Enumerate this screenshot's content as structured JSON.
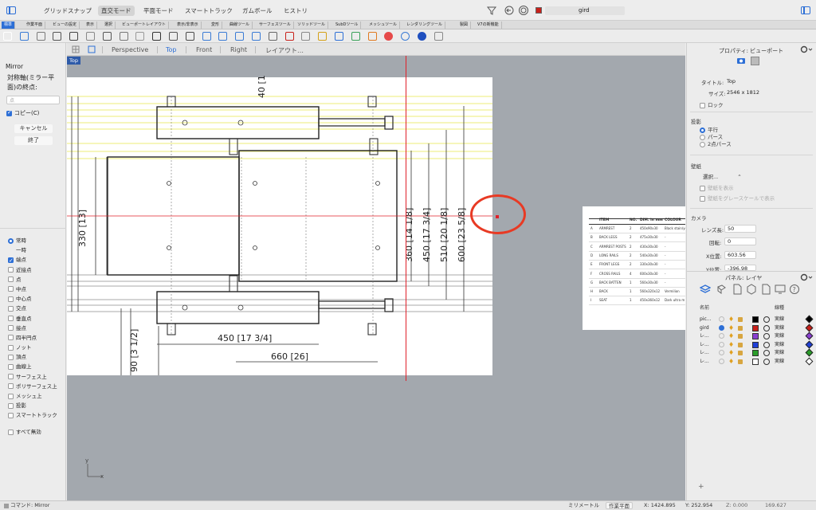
{
  "modebar": {
    "modes": [
      "グリッドスナップ",
      "直交モード",
      "平面モード",
      "スマートトラック",
      "ガムボール",
      "ヒストリ"
    ],
    "active_mode": "直交モード",
    "layer_name": "gird",
    "layer_color": "#c8201a"
  },
  "tabs": [
    "標準",
    "作業平面",
    "ビューの設定",
    "表示",
    "選択",
    "ビューポートレイアウト",
    "表示/非表示",
    "変形",
    "曲線ツール",
    "サーフェスツール",
    "ソリッドツール",
    "SubDツール",
    "メッシュツール",
    "レンダリングツール",
    "製図",
    "V7の新機能"
  ],
  "active_tab": "標準",
  "toolbar_icons": [
    "new-file",
    "open-file",
    "save-file",
    "save-as",
    "print",
    "copy-clipboard",
    "cut",
    "copy",
    "paste",
    "undo",
    "pan",
    "rotate-view",
    "zoom-window",
    "zoom-dynamic",
    "zoom-extents",
    "zoom-selected",
    "four-views",
    "car-object",
    "select-object",
    "hide-object",
    "light",
    "properties",
    "material-ball",
    "color-wheel",
    "environment",
    "render-sphere",
    "help"
  ],
  "command": {
    "name": "Mirror",
    "prompt": "対称軸(ミラー平面)の終点:",
    "input_placeholder": "点",
    "copy_option": "コピー(C)",
    "copy_checked": true,
    "cancel_label": "キャンセル",
    "finish_label": "終了"
  },
  "osnap": {
    "items": [
      {
        "label": "常時",
        "kind": "radio",
        "on": true,
        "sub": false
      },
      {
        "label": "一時",
        "kind": "text",
        "on": false,
        "sub": true
      },
      {
        "label": "端点",
        "kind": "check",
        "on": true,
        "sub": false
      },
      {
        "label": "近接点",
        "kind": "check",
        "on": false,
        "sub": false
      },
      {
        "label": "点",
        "kind": "check",
        "on": false,
        "sub": false
      },
      {
        "label": "中点",
        "kind": "check",
        "on": false,
        "sub": false
      },
      {
        "label": "中心点",
        "kind": "check",
        "on": false,
        "sub": false
      },
      {
        "label": "交点",
        "kind": "check",
        "on": false,
        "sub": false
      },
      {
        "label": "垂直点",
        "kind": "check",
        "on": false,
        "sub": false
      },
      {
        "label": "接点",
        "kind": "check",
        "on": false,
        "sub": false
      },
      {
        "label": "四半円点",
        "kind": "check",
        "on": false,
        "sub": false
      },
      {
        "label": "ノット",
        "kind": "check",
        "on": false,
        "sub": false
      },
      {
        "label": "頂点",
        "kind": "check",
        "on": false,
        "sub": false
      },
      {
        "label": "曲線上",
        "kind": "check",
        "on": false,
        "sub": false
      },
      {
        "label": "サーフェス上",
        "kind": "check",
        "on": false,
        "sub": false
      },
      {
        "label": "ポリサーフェス上",
        "kind": "check",
        "on": false,
        "sub": false
      },
      {
        "label": "メッシュ上",
        "kind": "check",
        "on": false,
        "sub": false
      },
      {
        "label": "投影",
        "kind": "check",
        "on": false,
        "sub": false
      },
      {
        "label": "スマートトラック",
        "kind": "check",
        "on": false,
        "sub": false
      }
    ],
    "disable_all": "すべて無効"
  },
  "viewport": {
    "tabs": [
      "Perspective",
      "Top",
      "Front",
      "Right",
      "レイアウト…"
    ],
    "active": "Top",
    "label": "Top",
    "dims": {
      "d40": "40 [1",
      "d330": "330 [13]",
      "d360": "360 [14 1/8]",
      "d450v": "450 [17 3/4]",
      "d510": "510 [20 1/8]",
      "d600": "600 [23 5/8]",
      "d450h": "450 [17 3/4]",
      "d660": "660 [26]",
      "d90": "90 [3 1/2]"
    },
    "axis_x": "x",
    "axis_y": "y",
    "table": {
      "headers": [
        "ITEM",
        "NO.",
        "DIM. in mm",
        "COLOUR"
      ],
      "rows": [
        [
          "A",
          "ARMREST",
          "2",
          "450x90x30",
          "Black stain/yellow lemon"
        ],
        [
          "B",
          "BACK LEGS",
          "2",
          "475x30x30",
          "-"
        ],
        [
          "C",
          "ARMREST POSTS",
          "2",
          "430x30x30",
          "-"
        ],
        [
          "D",
          "LONG RAILS",
          "2",
          "540x30x30",
          "-"
        ],
        [
          "E",
          "FRONT LEGS",
          "2",
          "330x30x30",
          "-"
        ],
        [
          "F",
          "CROSS RAILS",
          "4",
          "600x30x30",
          "-"
        ],
        [
          "G",
          "BACK BATTEN",
          "1",
          "560x30x30",
          "-"
        ],
        [
          "H",
          "BACK",
          "1",
          "560x320x12",
          "Vermilion"
        ],
        [
          "I",
          "SEAT",
          "1",
          "450x360x12",
          "Dark ultra m"
        ]
      ]
    }
  },
  "properties": {
    "header": "プロパティ: ビューポート",
    "title_label": "タイトル:",
    "title_value": "Top",
    "size_label": "サイズ:",
    "size_value": "2546 x 1812",
    "lock_label": "ロック",
    "projection_label": "投影",
    "projection_options": [
      "平行",
      "パース",
      "2点パース"
    ],
    "projection_selected": "平行",
    "wallpaper_label": "壁紙",
    "wallpaper_select": "選択...",
    "wallpaper_show": "壁紙を表示",
    "wallpaper_gray": "壁紙をグレースケールで表示",
    "camera_label": "カメラ",
    "lens_label": "レンズ長:",
    "lens_value": "50",
    "rotation_label": "回転:",
    "rotation_value": "0",
    "xpos_label": "X位置:",
    "xpos_value": "603.56",
    "ypos_label": "Y位置:",
    "ypos_value": "-396.98"
  },
  "layers": {
    "header": "パネル: レイヤ",
    "col_name": "名前",
    "col_linetype": "線種",
    "rows": [
      {
        "name": "pic...",
        "color": "#000000",
        "linetype": "実線",
        "current": false,
        "diamond": "#000000"
      },
      {
        "name": "gird",
        "color": "#c8201a",
        "linetype": "実線",
        "current": true,
        "diamond": "#c8201a"
      },
      {
        "name": "レ...",
        "color": "#8a3fd1",
        "linetype": "実線",
        "current": false,
        "diamond": "#8a3fd1"
      },
      {
        "name": "レ...",
        "color": "#1f3fd6",
        "linetype": "実線",
        "current": false,
        "diamond": "#1f3fd6"
      },
      {
        "name": "レ...",
        "color": "#2a9d2a",
        "linetype": "実線",
        "current": false,
        "diamond": "#2a9d2a"
      },
      {
        "name": "レ...",
        "color": "#ffffff",
        "linetype": "実線",
        "current": false,
        "diamond": "#ffffff"
      }
    ],
    "add_label": "+"
  },
  "status": {
    "command": "コマンド: Mirror",
    "units": "ミリメートル",
    "cplane": "作業平面",
    "x": "X: 1424.895",
    "y": "Y: 252.954",
    "z": "Z: 0.000",
    "extra": "169.627"
  }
}
